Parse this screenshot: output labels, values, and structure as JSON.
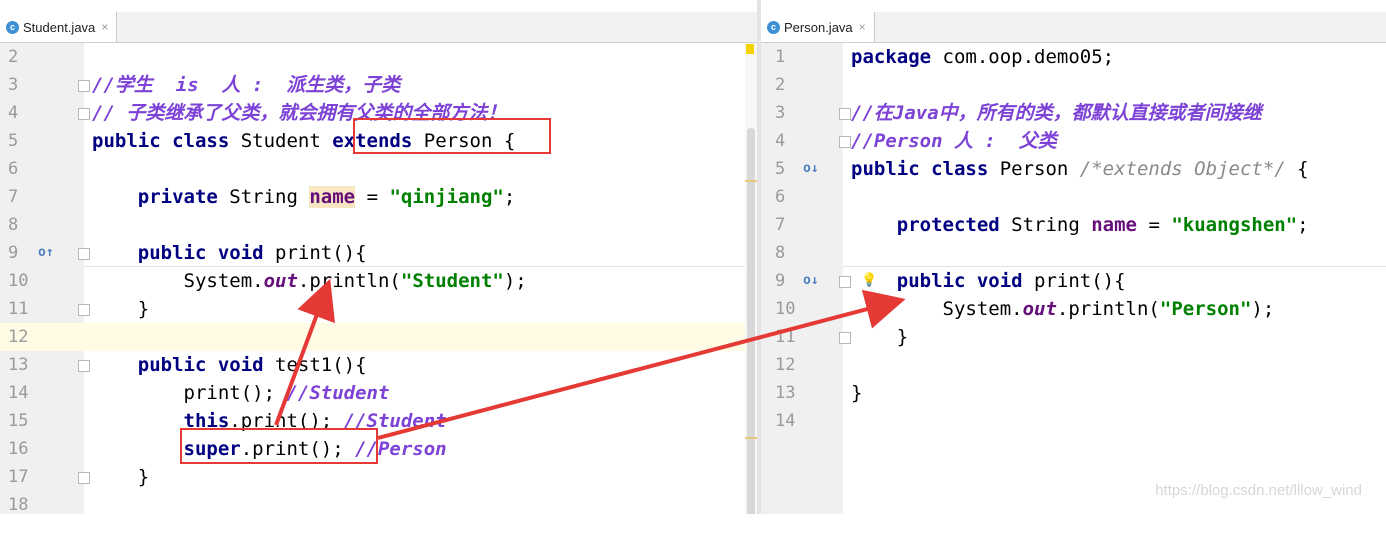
{
  "left_editor": {
    "tab_label": "Student.java",
    "tab_icon_letter": "c",
    "tab_close": "×",
    "lines": [
      {
        "n": "2"
      },
      {
        "n": "3",
        "parts": [
          {
            "t": "//学生  is  人 :  派生类，子类",
            "c": "cmt"
          }
        ]
      },
      {
        "n": "4",
        "parts": [
          {
            "t": "// 子类继承了父类，就会拥有父类的全部方法！",
            "c": "cmt"
          }
        ]
      },
      {
        "n": "5",
        "parts": [
          {
            "t": "public class ",
            "c": "kw"
          },
          {
            "t": "Student "
          },
          {
            "t": "extends ",
            "c": "kw"
          },
          {
            "t": "Person "
          },
          {
            "t": "{"
          }
        ]
      },
      {
        "n": "6"
      },
      {
        "n": "7",
        "parts": [
          {
            "t": "    private ",
            "c": "kw"
          },
          {
            "t": "String "
          },
          {
            "t": "name",
            "c": "fld hl-name"
          },
          {
            "t": " = "
          },
          {
            "t": "\"qinjiang\"",
            "c": "str"
          },
          {
            "t": ";"
          }
        ]
      },
      {
        "n": "8"
      },
      {
        "n": "9",
        "parts": [
          {
            "t": "    public void ",
            "c": "kw"
          },
          {
            "t": "print(){"
          }
        ]
      },
      {
        "n": "10",
        "parts": [
          {
            "t": "        System."
          },
          {
            "t": "out",
            "c": "stat"
          },
          {
            "t": ".println("
          },
          {
            "t": "\"Student\"",
            "c": "str"
          },
          {
            "t": ");"
          }
        ]
      },
      {
        "n": "11",
        "parts": [
          {
            "t": "    }"
          }
        ]
      },
      {
        "n": "12"
      },
      {
        "n": "13",
        "parts": [
          {
            "t": "    public void ",
            "c": "kw"
          },
          {
            "t": "test1(){"
          }
        ]
      },
      {
        "n": "14",
        "parts": [
          {
            "t": "        print(); "
          },
          {
            "t": "//Student",
            "c": "cmt"
          }
        ]
      },
      {
        "n": "15",
        "parts": [
          {
            "t": "        this",
            "c": "kw"
          },
          {
            "t": ".print(); "
          },
          {
            "t": "//Student",
            "c": "cmt"
          }
        ]
      },
      {
        "n": "16",
        "parts": [
          {
            "t": "        super",
            "c": "kw"
          },
          {
            "t": ".print(); "
          },
          {
            "t": "//Person",
            "c": "cmt"
          }
        ]
      },
      {
        "n": "17",
        "parts": [
          {
            "t": "    }"
          }
        ]
      },
      {
        "n": "18"
      }
    ]
  },
  "right_editor": {
    "tab_label": "Person.java",
    "tab_icon_letter": "c",
    "tab_close": "×",
    "lines": [
      {
        "n": "1",
        "parts": [
          {
            "t": "package ",
            "c": "kw"
          },
          {
            "t": "com.oop.demo05;"
          }
        ]
      },
      {
        "n": "2"
      },
      {
        "n": "3",
        "parts": [
          {
            "t": "//在Java中，所有的类，都默认直接或者间接继",
            "c": "cmt"
          }
        ]
      },
      {
        "n": "4",
        "parts": [
          {
            "t": "//Person 人 :  父类",
            "c": "cmt"
          }
        ]
      },
      {
        "n": "5",
        "parts": [
          {
            "t": "public class ",
            "c": "kw"
          },
          {
            "t": "Person "
          },
          {
            "t": "/*extends Object*/",
            "c": "cmt-g"
          },
          {
            "t": " {"
          }
        ]
      },
      {
        "n": "6"
      },
      {
        "n": "7",
        "parts": [
          {
            "t": "    protected ",
            "c": "kw"
          },
          {
            "t": "String "
          },
          {
            "t": "name",
            "c": "fld"
          },
          {
            "t": " = "
          },
          {
            "t": "\"kuangshen\"",
            "c": "str"
          },
          {
            "t": ";"
          }
        ]
      },
      {
        "n": "8"
      },
      {
        "n": "9",
        "parts": [
          {
            "t": "    public void ",
            "c": "kw"
          },
          {
            "t": "print(){"
          }
        ]
      },
      {
        "n": "10",
        "parts": [
          {
            "t": "        System."
          },
          {
            "t": "out",
            "c": "stat"
          },
          {
            "t": ".println("
          },
          {
            "t": "\"Person\"",
            "c": "str"
          },
          {
            "t": ");"
          }
        ]
      },
      {
        "n": "11",
        "parts": [
          {
            "t": "    }"
          }
        ]
      },
      {
        "n": "12"
      },
      {
        "n": "13",
        "parts": [
          {
            "t": "}"
          }
        ]
      },
      {
        "n": "14"
      }
    ]
  },
  "icons": {
    "override_up": "o↑",
    "override_down": "o↓",
    "bulb": "💡"
  },
  "colors": {
    "keyword": "#000080",
    "string": "#008000",
    "comment": "#7d42d6",
    "annotation_red": "#e53935"
  },
  "watermark": "https://blog.csdn.net/lllow_wind"
}
